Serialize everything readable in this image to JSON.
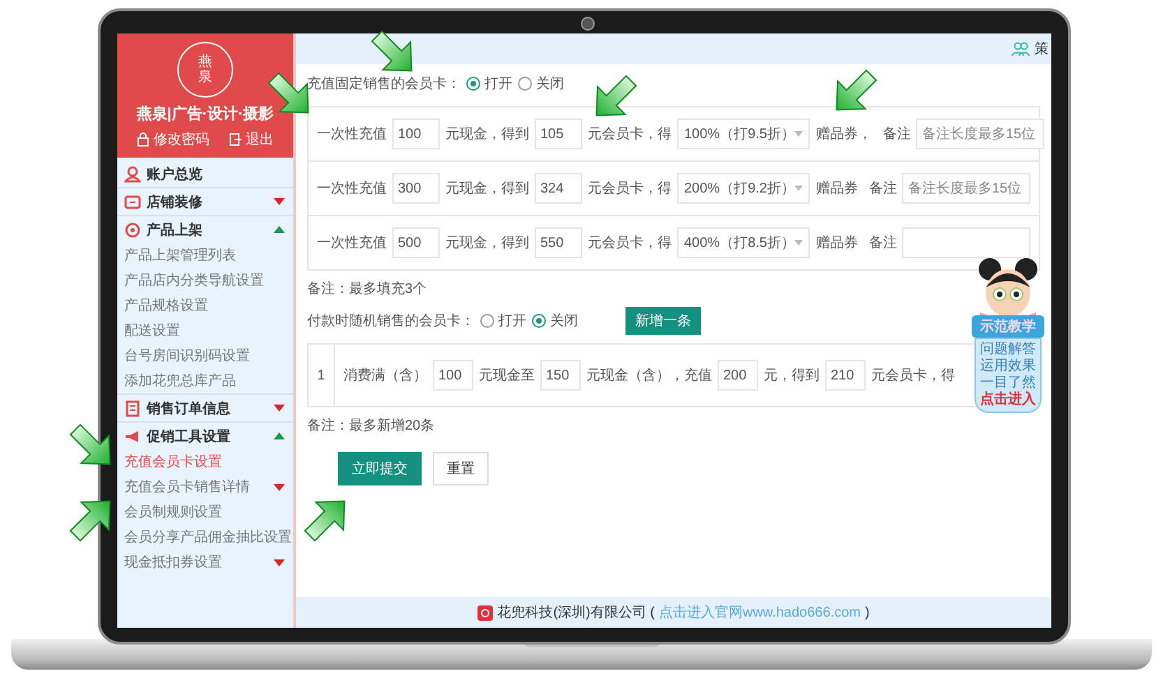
{
  "header": {
    "user_name": "策"
  },
  "sidebar": {
    "logo_text": "燕泉",
    "brand": "燕泉|广告·设计·摄影",
    "links": [
      "修改密码",
      "退出"
    ],
    "menu": [
      {
        "label": "账户总览",
        "kind": "link"
      },
      {
        "label": "店铺装修",
        "kind": "group",
        "expanded": false
      },
      {
        "label": "产品上架",
        "kind": "group",
        "expanded": true,
        "children": [
          {
            "label": "产品上架管理列表",
            "kind": "link",
            "selected": false
          },
          {
            "label": "产品店内分类导航设置",
            "kind": "link",
            "selected": false
          },
          {
            "label": "产品规格设置",
            "kind": "link",
            "selected": false
          },
          {
            "label": "配送设置",
            "kind": "link",
            "selected": false
          },
          {
            "label": "台号房间识别码设置",
            "kind": "link",
            "selected": false
          },
          {
            "label": "添加花兜总库产品",
            "kind": "link",
            "selected": false
          }
        ]
      },
      {
        "label": "销售订单信息",
        "kind": "group",
        "expanded": false
      },
      {
        "label": "促销工具设置",
        "kind": "group",
        "expanded": true,
        "children": [
          {
            "label": "充值会员卡设置",
            "kind": "link",
            "selected": true
          },
          {
            "label": "充值会员卡销售详情",
            "kind": "submenu",
            "selected": false
          },
          {
            "label": "会员制规则设置",
            "kind": "link",
            "selected": false
          },
          {
            "label": "会员分享产品佣金抽比设置",
            "kind": "link",
            "selected": false
          },
          {
            "label": "现金抵扣券设置",
            "kind": "submenu",
            "selected": false
          }
        ]
      }
    ]
  },
  "fixed_card": {
    "label": "充值固定销售的会员卡：",
    "options": [
      {
        "label": "打开",
        "selected": true
      },
      {
        "label": "关闭",
        "selected": false
      }
    ]
  },
  "fixed_rows": [
    {
      "prefix": "一次性充值",
      "charge": "100",
      "mid": "元现金，得到",
      "get": "105",
      "suffix": "元会员卡，得",
      "discount": "100%（打9.5折）",
      "gift": "赠品券，",
      "note_label": "备注",
      "note_placeholder": "备注长度最多15位"
    },
    {
      "prefix": "一次性充值",
      "charge": "300",
      "mid": "元现金，得到",
      "get": "324",
      "suffix": "元会员卡，得",
      "discount": "200%（打9.2折）",
      "gift": "赠品券",
      "note_label": "备注",
      "note_placeholder": "备注长度最多15位"
    },
    {
      "prefix": "一次性充值",
      "charge": "500",
      "mid": "元现金，得到",
      "get": "550",
      "suffix": "元会员卡，得",
      "discount": "400%（打8.5折）",
      "gift": "赠品券",
      "note_label": "备注"
    }
  ],
  "fixed_note": "备注：最多填充3个",
  "random_card": {
    "label": "付款时随机销售的会员卡：",
    "options": [
      {
        "label": "打开",
        "selected": false
      },
      {
        "label": "关闭",
        "selected": true
      }
    ],
    "add_button": "新增一条"
  },
  "random_rows": [
    {
      "index": "1",
      "texts": [
        "消费满（含）",
        "元现金至",
        "元现金（含），充值",
        "元，得到",
        "元会员卡，得"
      ],
      "values": [
        "100",
        "150",
        "200",
        "210"
      ]
    }
  ],
  "random_note": "备注：最多新增20条",
  "actions": [
    {
      "label": "立即提交",
      "kind": "primary"
    },
    {
      "label": "重置",
      "kind": "default"
    }
  ],
  "footer": {
    "company": "花兜科技(深圳)有限公司 (",
    "link": "点击进入官网www.hado666.com",
    "close": ")"
  },
  "mascot": {
    "ribbon": "示范教学",
    "lines": [
      "问题解答",
      "运用效果",
      "一目了然"
    ],
    "action": "点击进入"
  }
}
